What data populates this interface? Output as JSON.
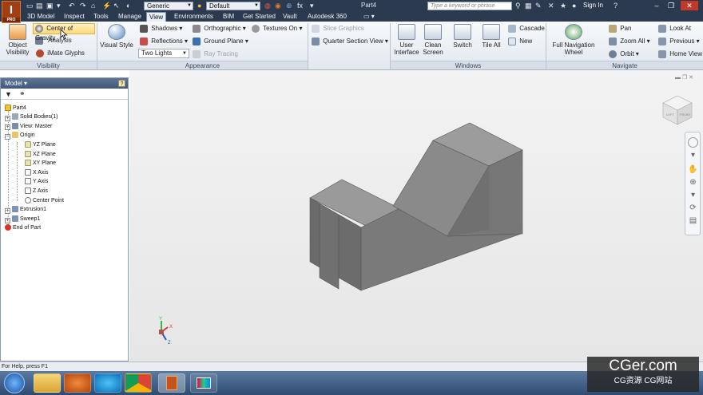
{
  "app": {
    "logo_letter": "I",
    "logo_sub": "PRO",
    "doc_title": "Part4",
    "search_placeholder": "Type a keyword or phrase",
    "sign_in": "Sign In",
    "material_combo": "Generic",
    "appearance_combo": "Default"
  },
  "tabs": [
    "3D Model",
    "Inspect",
    "Tools",
    "Manage",
    "View",
    "Environments",
    "BIM",
    "Get Started",
    "Vault",
    "Autodesk 360"
  ],
  "active_tab": "View",
  "ribbon": {
    "visibility": {
      "object_visibility": "Object\nVisibility",
      "center_of_gravity": "Center of Gravity",
      "analysis": "Analysis",
      "imate_glyphs": "iMate Glyphs",
      "label": "Visibility"
    },
    "appearance": {
      "visual_style": "Visual Style",
      "shadows": "Shadows",
      "reflections": "Reflections",
      "two_lights": "Two Lights",
      "orthographic": "Orthographic",
      "ground_plane": "Ground Plane",
      "ray_tracing": "Ray Tracing",
      "textures_on": "Textures On",
      "label": "Appearance"
    },
    "section": {
      "slice_graphics": "Slice Graphics",
      "quarter_section_view": "Quarter Section View"
    },
    "windows": {
      "user_interface": "User\nInterface",
      "clean_screen": "Clean\nScreen",
      "switch": "Switch",
      "tile_all": "Tile All",
      "cascade": "Cascade",
      "new": "New",
      "label": "Windows"
    },
    "navigate": {
      "full_navigation_wheel": "Full Navigation\nWheel",
      "pan": "Pan",
      "zoom_all": "Zoom All",
      "orbit": "Orbit",
      "look_at": "Look At",
      "previous": "Previous",
      "home_view": "Home View",
      "label": "Navigate"
    }
  },
  "browser": {
    "title": "Model",
    "help": "?",
    "items": [
      {
        "label": "Part4"
      },
      {
        "label": "Solid Bodies(1)"
      },
      {
        "label": "View: Master"
      },
      {
        "label": "Origin"
      },
      {
        "label": "YZ Plane"
      },
      {
        "label": "XZ Plane"
      },
      {
        "label": "XY Plane"
      },
      {
        "label": "X Axis"
      },
      {
        "label": "Y Axis"
      },
      {
        "label": "Z Axis"
      },
      {
        "label": "Center Point"
      },
      {
        "label": "Extrusion1"
      },
      {
        "label": "Sweep1"
      },
      {
        "label": "End of Part"
      }
    ]
  },
  "viewcube": {
    "top": "",
    "front": "LEFT",
    "right": "FRONT"
  },
  "triad": {
    "x": "X",
    "y": "Y",
    "z": "Z"
  },
  "status": {
    "text": "For Help, press F1"
  },
  "watermark": {
    "big": "CGer.com",
    "small": "CG资源 CG网站"
  },
  "colors": {
    "titlebar": "#2b3a4e",
    "ribbon_highlight": "#ffd97a",
    "model_face": "#808080"
  }
}
